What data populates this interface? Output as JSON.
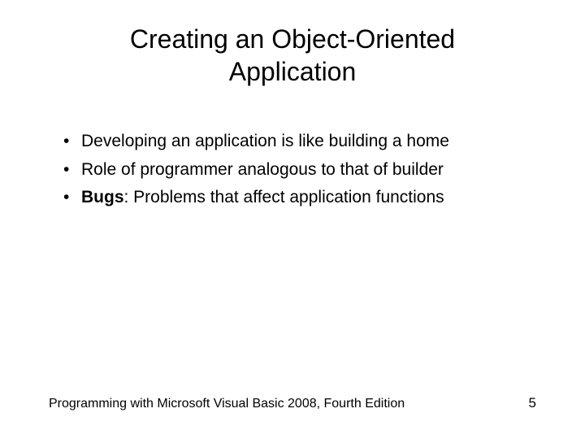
{
  "title": "Creating an Object-Oriented Application",
  "bullets": [
    {
      "prefix": "",
      "bold": "",
      "text": "Developing an application is like building a home"
    },
    {
      "prefix": "",
      "bold": "",
      "text": "Role of programmer analogous to that of builder"
    },
    {
      "prefix": "",
      "bold": "Bugs",
      "text": ": Problems that affect application functions"
    }
  ],
  "footer": {
    "text": "Programming with Microsoft Visual Basic 2008, Fourth Edition",
    "page": "5"
  }
}
